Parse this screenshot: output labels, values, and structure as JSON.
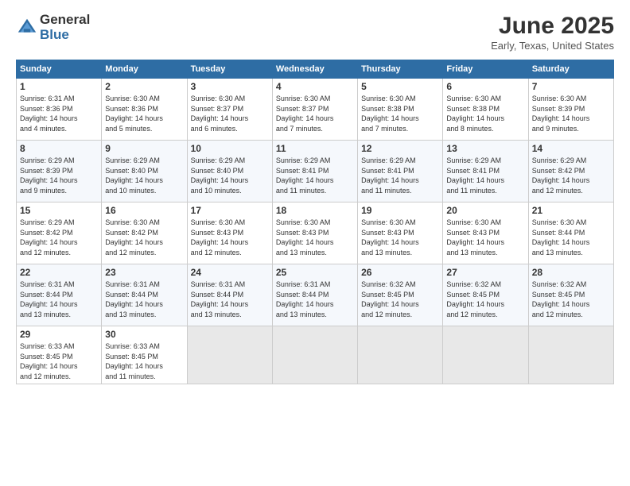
{
  "header": {
    "logo_general": "General",
    "logo_blue": "Blue",
    "month_title": "June 2025",
    "location": "Early, Texas, United States"
  },
  "days_of_week": [
    "Sunday",
    "Monday",
    "Tuesday",
    "Wednesday",
    "Thursday",
    "Friday",
    "Saturday"
  ],
  "weeks": [
    [
      {
        "day": 1,
        "info": "Sunrise: 6:31 AM\nSunset: 8:36 PM\nDaylight: 14 hours\nand 4 minutes."
      },
      {
        "day": 2,
        "info": "Sunrise: 6:30 AM\nSunset: 8:36 PM\nDaylight: 14 hours\nand 5 minutes."
      },
      {
        "day": 3,
        "info": "Sunrise: 6:30 AM\nSunset: 8:37 PM\nDaylight: 14 hours\nand 6 minutes."
      },
      {
        "day": 4,
        "info": "Sunrise: 6:30 AM\nSunset: 8:37 PM\nDaylight: 14 hours\nand 7 minutes."
      },
      {
        "day": 5,
        "info": "Sunrise: 6:30 AM\nSunset: 8:38 PM\nDaylight: 14 hours\nand 7 minutes."
      },
      {
        "day": 6,
        "info": "Sunrise: 6:30 AM\nSunset: 8:38 PM\nDaylight: 14 hours\nand 8 minutes."
      },
      {
        "day": 7,
        "info": "Sunrise: 6:30 AM\nSunset: 8:39 PM\nDaylight: 14 hours\nand 9 minutes."
      }
    ],
    [
      {
        "day": 8,
        "info": "Sunrise: 6:29 AM\nSunset: 8:39 PM\nDaylight: 14 hours\nand 9 minutes."
      },
      {
        "day": 9,
        "info": "Sunrise: 6:29 AM\nSunset: 8:40 PM\nDaylight: 14 hours\nand 10 minutes."
      },
      {
        "day": 10,
        "info": "Sunrise: 6:29 AM\nSunset: 8:40 PM\nDaylight: 14 hours\nand 10 minutes."
      },
      {
        "day": 11,
        "info": "Sunrise: 6:29 AM\nSunset: 8:41 PM\nDaylight: 14 hours\nand 11 minutes."
      },
      {
        "day": 12,
        "info": "Sunrise: 6:29 AM\nSunset: 8:41 PM\nDaylight: 14 hours\nand 11 minutes."
      },
      {
        "day": 13,
        "info": "Sunrise: 6:29 AM\nSunset: 8:41 PM\nDaylight: 14 hours\nand 11 minutes."
      },
      {
        "day": 14,
        "info": "Sunrise: 6:29 AM\nSunset: 8:42 PM\nDaylight: 14 hours\nand 12 minutes."
      }
    ],
    [
      {
        "day": 15,
        "info": "Sunrise: 6:29 AM\nSunset: 8:42 PM\nDaylight: 14 hours\nand 12 minutes."
      },
      {
        "day": 16,
        "info": "Sunrise: 6:30 AM\nSunset: 8:42 PM\nDaylight: 14 hours\nand 12 minutes."
      },
      {
        "day": 17,
        "info": "Sunrise: 6:30 AM\nSunset: 8:43 PM\nDaylight: 14 hours\nand 12 minutes."
      },
      {
        "day": 18,
        "info": "Sunrise: 6:30 AM\nSunset: 8:43 PM\nDaylight: 14 hours\nand 13 minutes."
      },
      {
        "day": 19,
        "info": "Sunrise: 6:30 AM\nSunset: 8:43 PM\nDaylight: 14 hours\nand 13 minutes."
      },
      {
        "day": 20,
        "info": "Sunrise: 6:30 AM\nSunset: 8:43 PM\nDaylight: 14 hours\nand 13 minutes."
      },
      {
        "day": 21,
        "info": "Sunrise: 6:30 AM\nSunset: 8:44 PM\nDaylight: 14 hours\nand 13 minutes."
      }
    ],
    [
      {
        "day": 22,
        "info": "Sunrise: 6:31 AM\nSunset: 8:44 PM\nDaylight: 14 hours\nand 13 minutes."
      },
      {
        "day": 23,
        "info": "Sunrise: 6:31 AM\nSunset: 8:44 PM\nDaylight: 14 hours\nand 13 minutes."
      },
      {
        "day": 24,
        "info": "Sunrise: 6:31 AM\nSunset: 8:44 PM\nDaylight: 14 hours\nand 13 minutes."
      },
      {
        "day": 25,
        "info": "Sunrise: 6:31 AM\nSunset: 8:44 PM\nDaylight: 14 hours\nand 13 minutes."
      },
      {
        "day": 26,
        "info": "Sunrise: 6:32 AM\nSunset: 8:45 PM\nDaylight: 14 hours\nand 12 minutes."
      },
      {
        "day": 27,
        "info": "Sunrise: 6:32 AM\nSunset: 8:45 PM\nDaylight: 14 hours\nand 12 minutes."
      },
      {
        "day": 28,
        "info": "Sunrise: 6:32 AM\nSunset: 8:45 PM\nDaylight: 14 hours\nand 12 minutes."
      }
    ],
    [
      {
        "day": 29,
        "info": "Sunrise: 6:33 AM\nSunset: 8:45 PM\nDaylight: 14 hours\nand 12 minutes."
      },
      {
        "day": 30,
        "info": "Sunrise: 6:33 AM\nSunset: 8:45 PM\nDaylight: 14 hours\nand 11 minutes."
      },
      null,
      null,
      null,
      null,
      null
    ]
  ]
}
